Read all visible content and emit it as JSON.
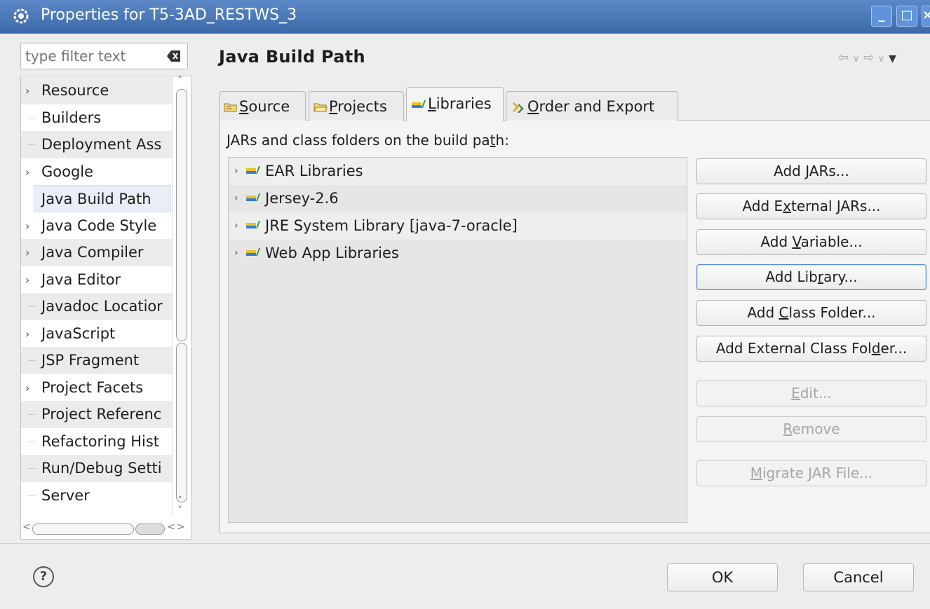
{
  "window": {
    "title": "Properties for T5-3AD_RESTWS_3",
    "buttons": {
      "minimize": "_",
      "maximize": "□",
      "close": "×"
    }
  },
  "filter": {
    "placeholder": "type filter text"
  },
  "tree": {
    "items": [
      {
        "label": "Resource",
        "expandable": true
      },
      {
        "label": "Builders",
        "expandable": false
      },
      {
        "label": "Deployment Ass",
        "expandable": false
      },
      {
        "label": "Google",
        "expandable": true
      },
      {
        "label": "Java Build Path",
        "expandable": false,
        "selected": true
      },
      {
        "label": "Java Code Style",
        "expandable": true
      },
      {
        "label": "Java Compiler",
        "expandable": true
      },
      {
        "label": "Java Editor",
        "expandable": true
      },
      {
        "label": "Javadoc Locatior",
        "expandable": false
      },
      {
        "label": "JavaScript",
        "expandable": true
      },
      {
        "label": "JSP Fragment",
        "expandable": false
      },
      {
        "label": "Project Facets",
        "expandable": true
      },
      {
        "label": "Project Referenc",
        "expandable": false
      },
      {
        "label": "Refactoring Hist",
        "expandable": false
      },
      {
        "label": "Run/Debug Setti",
        "expandable": false
      },
      {
        "label": "Server",
        "expandable": false
      }
    ]
  },
  "page": {
    "title": "Java Build Path"
  },
  "tabs": [
    {
      "label": "Source",
      "mnemonic": "S",
      "rest": "ource",
      "icon": "source-folder-icon"
    },
    {
      "label": "Projects",
      "mnemonic": "P",
      "rest": "rojects",
      "icon": "projects-folder-icon"
    },
    {
      "label": "Libraries",
      "mnemonic": "L",
      "rest": "ibraries",
      "icon": "libraries-icon",
      "active": true
    },
    {
      "label": "Order and Export",
      "mnemonic": "O",
      "rest": "rder and Export",
      "icon": "order-export-icon"
    }
  ],
  "libraries": {
    "label_pre": "JARs and class folders on the build pa",
    "label_mn": "t",
    "label_post": "h:",
    "items": [
      "EAR Libraries",
      "Jersey-2.6",
      "JRE System Library [java-7-oracle]",
      "Web App Libraries"
    ]
  },
  "buttons": {
    "add_jars": {
      "pre": "Add ",
      "mn": "J",
      "post": "ARs..."
    },
    "add_external_jars": {
      "pre": "Add E",
      "mn": "x",
      "post": "ternal JARs..."
    },
    "add_variable": {
      "pre": "Add ",
      "mn": "V",
      "post": "ariable..."
    },
    "add_library": {
      "pre": "Add Lib",
      "mn": "r",
      "post": "ary..."
    },
    "add_class_folder": {
      "pre": "Add ",
      "mn": "C",
      "post": "lass Folder..."
    },
    "add_external_class_folder": {
      "pre": "Add External Class Fol",
      "mn": "d",
      "post": "er..."
    },
    "edit": {
      "pre": "",
      "mn": "E",
      "post": "dit..."
    },
    "remove": {
      "pre": "",
      "mn": "R",
      "post": "emove"
    },
    "migrate_jar": {
      "pre": "",
      "mn": "M",
      "post": "igrate JAR File..."
    }
  },
  "dialog": {
    "ok": "OK",
    "cancel": "Cancel",
    "help": "?"
  },
  "colors": {
    "titlebar": "#3c6aaa",
    "selection": "#e9eef6",
    "focus_border": "#5a8ad0"
  }
}
